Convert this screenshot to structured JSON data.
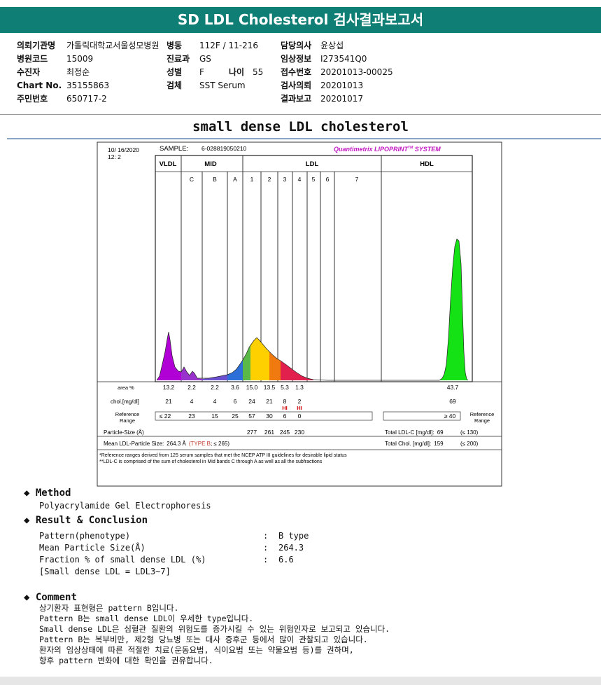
{
  "title": "SD LDL Cholesterol 검사결과보고서",
  "patient_info": {
    "col1": [
      {
        "label": "의뢰기관명",
        "value": "가톨릭대학교서울성모병원"
      },
      {
        "label": "병원코드",
        "value": "15009"
      },
      {
        "label": "수진자",
        "value": "최정순"
      },
      {
        "label": "Chart No.",
        "value": "35155863"
      },
      {
        "label": "주민번호",
        "value": "650717-2"
      }
    ],
    "col2": [
      {
        "label": "병동",
        "value": "112F / 11-216"
      },
      {
        "label": "진료과",
        "value": "GS"
      },
      {
        "label": "성별",
        "value": "F"
      },
      {
        "label": "검체",
        "value": "SST Serum"
      }
    ],
    "age_label": "나이",
    "age_value": "55",
    "col3": [
      {
        "label": "담당의사",
        "value": "윤상섭"
      },
      {
        "label": "임상정보",
        "value": "I273541Q0"
      },
      {
        "label": "접수번호",
        "value": "20201013-00025"
      },
      {
        "label": "검사의뢰",
        "value": "20201013"
      },
      {
        "label": "결과보고",
        "value": "20201017"
      }
    ]
  },
  "subtitle": "small dense LDL cholesterol",
  "report": {
    "date": "10/ 16/2020",
    "time": "12: 2",
    "sample_label": "SAMPLE:",
    "sample_id": "6-028819050210",
    "system_name": "Quantimetrix LIPOPRINT",
    "system_tm": "TM",
    "system_suffix": " SYSTEM",
    "system_color": "#c219c2",
    "groups": [
      "VLDL",
      "MID",
      "LDL",
      "HDL"
    ],
    "bands": [
      "C",
      "B",
      "A",
      "1",
      "2",
      "3",
      "4",
      "5",
      "6",
      "7"
    ],
    "area_label": "area %",
    "area_values": [
      "13.2",
      "2.2",
      "2.2",
      "3.6",
      "15.0",
      "13.5",
      "5.3",
      "1.3"
    ],
    "area_hdl": "43.7",
    "chol_label": "chol.[mg/dl]",
    "chol_values": [
      "21",
      "4",
      "4",
      "6",
      "24",
      "21",
      "8",
      "2"
    ],
    "chol_hdl": "69",
    "hi_flags": [
      "HI",
      "HI"
    ],
    "hi_color": "#d00000",
    "ref_label": "Reference Range",
    "ref_values": [
      "≤ 22",
      "23",
      "15",
      "25",
      "57",
      "30",
      "6",
      "0"
    ],
    "ref_hdl": "≥ 40",
    "ref_right_label": "Reference Range",
    "particle_label": "Particle-Size (Å)",
    "particle_values": [
      "277",
      "261",
      "245",
      "230"
    ],
    "mean_label": "Mean LDL-Particle Size:",
    "mean_value": "264.3 Å",
    "type_text": "(TYPE B",
    "type_suffix": "; ≤ 265)",
    "total_ldl_label": "Total LDL-C [mg/dl]:",
    "total_ldl_value": "69",
    "total_ldl_ref": "(≤ 130)",
    "total_chol_label": "Total Chol. [mg/dl]:",
    "total_chol_value": "159",
    "total_chol_ref": "(≤ 200)",
    "footnote1": "*Reference ranges derived from 125 serum samples that met the NCEP ATP III guidelines for desirable lipid status",
    "footnote2": "**LDL-C is comprised of the sum of cholesterol in Mid bands C through A as well as all the subfractions",
    "colors": {
      "vldl": "#b000d6",
      "mid_c": "#9a32cd",
      "mid_b": "#6a4fcf",
      "mid_a": "#2c6fd8",
      "ldl1": "#5ab846",
      "ldl2": "#ffd000",
      "ldl3": "#f07a10",
      "ldl4": "#e2204e",
      "hdl": "#14e214"
    }
  },
  "method": {
    "heading": "Method",
    "text": "Polyacrylamide Gel Electrophoresis"
  },
  "result": {
    "heading": "Result & Conclusion",
    "rows": [
      {
        "label": "Pattern(phenotype)",
        "sep": ":",
        "value": "B type"
      },
      {
        "label": "Mean Particle Size(Å)",
        "sep": ":",
        "value": "264.3"
      },
      {
        "label": "Fraction % of small dense LDL (%)",
        "sep": ":",
        "value": "6.6"
      }
    ],
    "note": "[Small dense LDL = LDL3~7]"
  },
  "comment": {
    "heading": "Comment",
    "lines": [
      "상기환자 표현형은 pattern B입니다.",
      "Pattern B는 small dense LDL이 우세한 type입니다.",
      "Small dense LDL은 심혈관 질환의 위험도를 증가시킬 수 있는 위험인자로 보고되고 있습니다.",
      "Pattern B는 복부비만, 제2형 당뇨병 또는 대사 증후군 등에서 많이 관찰되고 있습니다.",
      "환자의 임상상태에 따른 적절한 치료(운동요법, 식이요법 또는 약물요법 등)를 권하며,",
      "향후 pattern 변화에 대한 확인을 권유합니다."
    ]
  }
}
